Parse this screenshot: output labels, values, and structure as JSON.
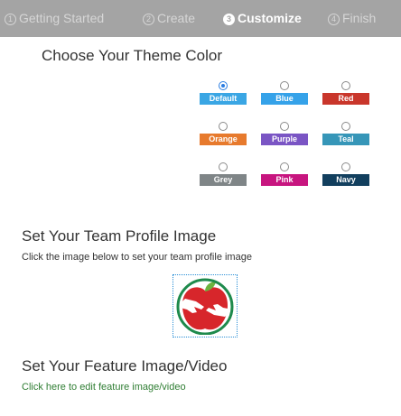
{
  "wizard": {
    "steps": [
      {
        "num": "1",
        "label": "Getting Started",
        "active": false
      },
      {
        "num": "2",
        "label": "Create",
        "active": false
      },
      {
        "num": "3",
        "label": "Customize",
        "active": true
      },
      {
        "num": "4",
        "label": "Finish",
        "active": false
      }
    ]
  },
  "theme": {
    "heading": "Choose Your Theme Color",
    "selected": "Default",
    "swatches": [
      {
        "label": "Default",
        "color": "#3aa6e4"
      },
      {
        "label": "Blue",
        "color": "#35a2e9"
      },
      {
        "label": "Red",
        "color": "#c9362b"
      },
      {
        "label": "Orange",
        "color": "#e77a2d"
      },
      {
        "label": "Purple",
        "color": "#7a55c4"
      },
      {
        "label": "Teal",
        "color": "#3696b8"
      },
      {
        "label": "Grey",
        "color": "#7f8587"
      },
      {
        "label": "Pink",
        "color": "#c7157f"
      },
      {
        "label": "Navy",
        "color": "#123f5e"
      }
    ]
  },
  "team_profile": {
    "heading": "Set Your Team Profile Image",
    "description": "Click the image below to set your team profile image",
    "image_icon": "apple-hands-logo-icon"
  },
  "feature": {
    "heading": "Set Your Feature Image/Video",
    "link_text": "Click here to edit feature image/video",
    "link_color": "#2e7d32"
  }
}
